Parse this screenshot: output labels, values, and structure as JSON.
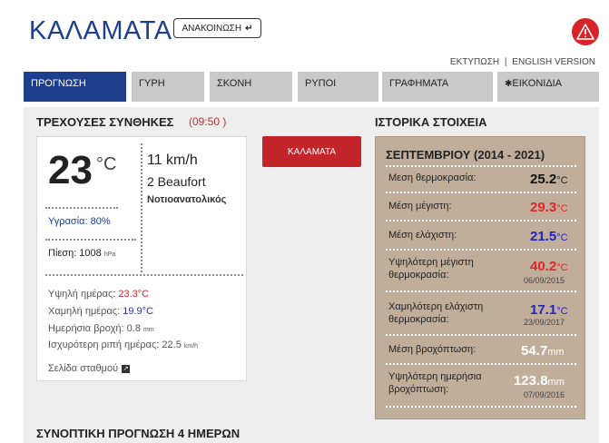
{
  "header": {
    "title": "ΚΑΛΑΜΑΤΑ",
    "announce_label": "ΑΝΑΚΟΙΝΩΣΗ",
    "announce_icon": "arrow-turn-icon",
    "warning_icon": "warning-icon",
    "print_link": "ΕΚΤΥΠΩΣΗ",
    "separator": "|",
    "english_link": "ENGLISH VERSION"
  },
  "tabs": [
    {
      "label": "ΠΡΟΓΝΩΣΗ",
      "active": true
    },
    {
      "label": "ΓΥΡΗ",
      "active": false
    },
    {
      "label": "ΣΚΟΝΗ",
      "active": false
    },
    {
      "label": "ΡΥΠΟΙ",
      "active": false
    },
    {
      "label": "ΓΡΑΦΗΜΑΤΑ",
      "active": false
    },
    {
      "label": "ΕΙΚΟΝΙΔΙΑ",
      "active": false,
      "icon": "gear-icon"
    }
  ],
  "current": {
    "title": "ΤΡΕΧΟΥΣΕΣ ΣΥΝΘΗΚΕΣ",
    "time": "(09:50 )",
    "temperature": "23",
    "temp_unit": "°C",
    "humidity": "Υγρασία: 80%",
    "pressure_label": "Πίεση: 1008",
    "pressure_unit": "hPa",
    "wind_speed": "11 km/h",
    "wind_beaufort": "2 Beaufort",
    "wind_direction": "Νοτιοανατολικός",
    "high_label": "Υψηλή ημέρας:",
    "high_value": "23.3°C",
    "low_label": "Χαμηλή ημέρας:",
    "low_value": "19.9°C",
    "rain_label": "Ημερήσια βροχή:",
    "rain_value": "0.8",
    "rain_unit": "mm",
    "rate_label": "Ισχυρότερη ριπή ημέρας:",
    "rate_value": "22.5",
    "rate_unit": "km/h",
    "station_link": "Σελίδα σταθμού",
    "station_icon": "external-link-icon"
  },
  "city_button": "ΚΑΛΑΜΑΤΑ",
  "history": {
    "title": "ΙΣΤΟΡΙΚΑ ΣΤΟΙΧΕΙΑ",
    "period": "ΣΕΠΤΕΜΒΡΙΟΥ (2014 - 2021)",
    "rows": [
      {
        "label": "Μεση θερμοκρασία:",
        "value": "25.2",
        "unit": "°C",
        "color": "#111111",
        "date": ""
      },
      {
        "label": "Μέση μέγιστη:",
        "value": "29.3",
        "unit": "°C",
        "color": "#e0262c",
        "date": ""
      },
      {
        "label": "Μέση ελάχιστη:",
        "value": "21.5",
        "unit": "°C",
        "color": "#2222c8",
        "date": ""
      },
      {
        "label": "Υψηλότερη μέγιστη θερμοκρασία:",
        "value": "40.2",
        "unit": "°C",
        "color": "#e0262c",
        "date": "06/09/2015"
      },
      {
        "label": "Χαμηλότερη ελάχιστη θερμοκρασία:",
        "value": "17.1",
        "unit": "°C",
        "color": "#2222c8",
        "date": "23/09/2017"
      },
      {
        "label": "Μέση βροχόπτωση:",
        "value": "54.7",
        "unit": "mm",
        "color": "#ffffff",
        "date": ""
      },
      {
        "label": "Υψηλότερη ημερήσια βροχόπτωση:",
        "value": "123.8",
        "unit": "mm",
        "color": "#ffffff",
        "date": "07/09/2016"
      }
    ]
  },
  "forecast_title": "ΣΥΝΟΠΤΙΚΗ ΠΡΟΓΝΩΣΗ 4 ΗΜΕΡΩΝ",
  "colors": {
    "brand": "#1d3f8e",
    "accent": "#c4252b",
    "history_bg": "#c1ae9a"
  }
}
